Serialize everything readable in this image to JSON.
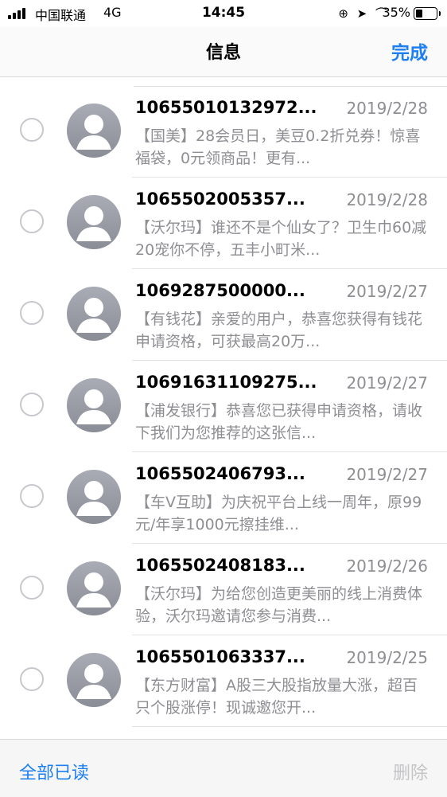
{
  "status_bar": {
    "carrier": "中国联通",
    "network": "4G",
    "time": "14:45",
    "icons": "⊕ ➤ ⌒",
    "battery": "35%",
    "battery_level": 0.35
  },
  "nav": {
    "title": "信息",
    "done_label": "完成"
  },
  "messages": [
    {
      "sender": "10655010132972...",
      "date": "2019/2/28",
      "preview": "【国美】28会员日，美豆0.2折兑券！惊喜福袋，0元领商品！更有..."
    },
    {
      "sender": "1065502005357...",
      "date": "2019/2/28",
      "preview": "【沃尔玛】谁还不是个仙女了？卫生巾60减20宠你不停，五丰小町米..."
    },
    {
      "sender": "1069287500000...",
      "date": "2019/2/27",
      "preview": "【有钱花】亲爱的用户，恭喜您获得有钱花申请资格，可获最高20万..."
    },
    {
      "sender": "10691631109275...",
      "date": "2019/2/27",
      "preview": "【浦发银行】恭喜您已获得申请资格，请收下我们为您推荐的这张信..."
    },
    {
      "sender": "1065502406793...",
      "date": "2019/2/27",
      "preview": "【车V互助】为庆祝平台上线一周年，原99元/年享1000元擦挂维..."
    },
    {
      "sender": "1065502408183...",
      "date": "2019/2/26",
      "preview": "【沃尔玛】为给您创造更美丽的线上消费体验，沃尔玛邀请您参与消费..."
    },
    {
      "sender": "1065501063337...",
      "date": "2019/2/25",
      "preview": "【东方财富】A股三大股指放量大涨，超百只个股涨停！现诚邀您开..."
    }
  ],
  "partial_row_sender": "一一一一",
  "toolbar": {
    "mark_all_read": "全部已读",
    "delete": "删除"
  },
  "colors": {
    "accent": "#1d7ff0",
    "disabled": "#c4c4c7",
    "secondary_text": "#8e8e93"
  }
}
